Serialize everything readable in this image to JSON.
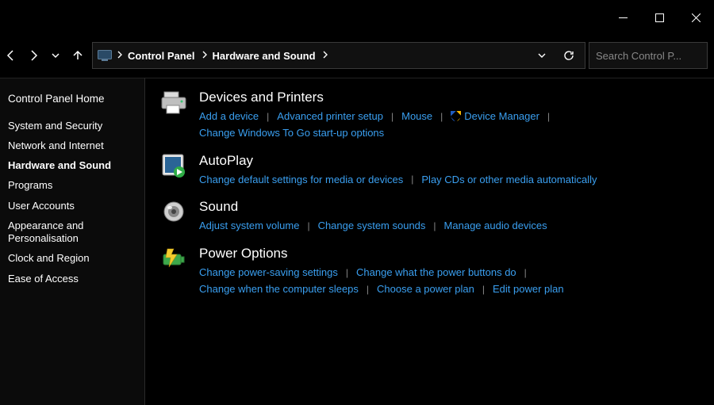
{
  "breadcrumb": {
    "items": [
      "Control Panel",
      "Hardware and Sound"
    ]
  },
  "search": {
    "placeholder": "Search Control P..."
  },
  "sidebar": {
    "home": "Control Panel Home",
    "items": [
      "System and Security",
      "Network and Internet",
      "Hardware and Sound",
      "Programs",
      "User Accounts",
      "Appearance and Personalisation",
      "Clock and Region",
      "Ease of Access"
    ],
    "current_index": 2
  },
  "categories": [
    {
      "icon": "printer",
      "title": "Devices and Printers",
      "links": [
        {
          "label": "Add a device"
        },
        {
          "label": "Advanced printer setup"
        },
        {
          "label": "Mouse"
        },
        {
          "label": "Device Manager",
          "shield": true
        },
        {
          "label": "Change Windows To Go start-up options",
          "wrap": true
        }
      ]
    },
    {
      "icon": "autoplay",
      "title": "AutoPlay",
      "links": [
        {
          "label": "Change default settings for media or devices"
        },
        {
          "label": "Play CDs or other media automatically"
        }
      ]
    },
    {
      "icon": "sound",
      "title": "Sound",
      "links": [
        {
          "label": "Adjust system volume"
        },
        {
          "label": "Change system sounds"
        },
        {
          "label": "Manage audio devices"
        }
      ]
    },
    {
      "icon": "power",
      "title": "Power Options",
      "links": [
        {
          "label": "Change power-saving settings"
        },
        {
          "label": "Change what the power buttons do"
        },
        {
          "label": "Change when the computer sleeps",
          "wrap": true
        },
        {
          "label": "Choose a power plan"
        },
        {
          "label": "Edit power plan"
        }
      ]
    }
  ]
}
